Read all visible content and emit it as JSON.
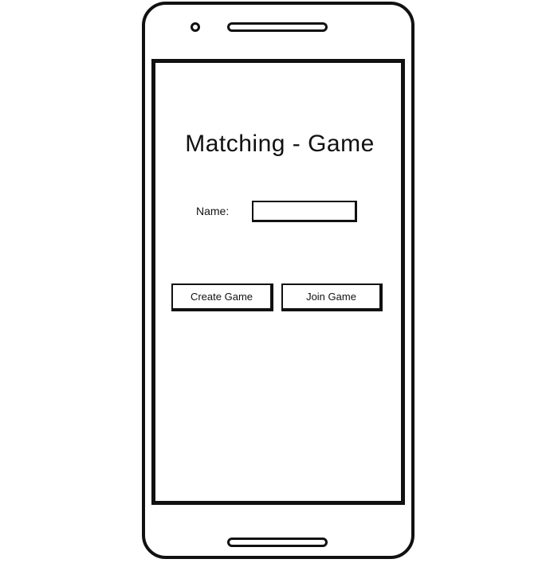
{
  "screen": {
    "title": "Matching - Game",
    "name_label": "Name:",
    "name_input": {
      "value": "",
      "placeholder": ""
    },
    "buttons": {
      "create_label": "Create Game",
      "join_label": "Join Game"
    }
  }
}
